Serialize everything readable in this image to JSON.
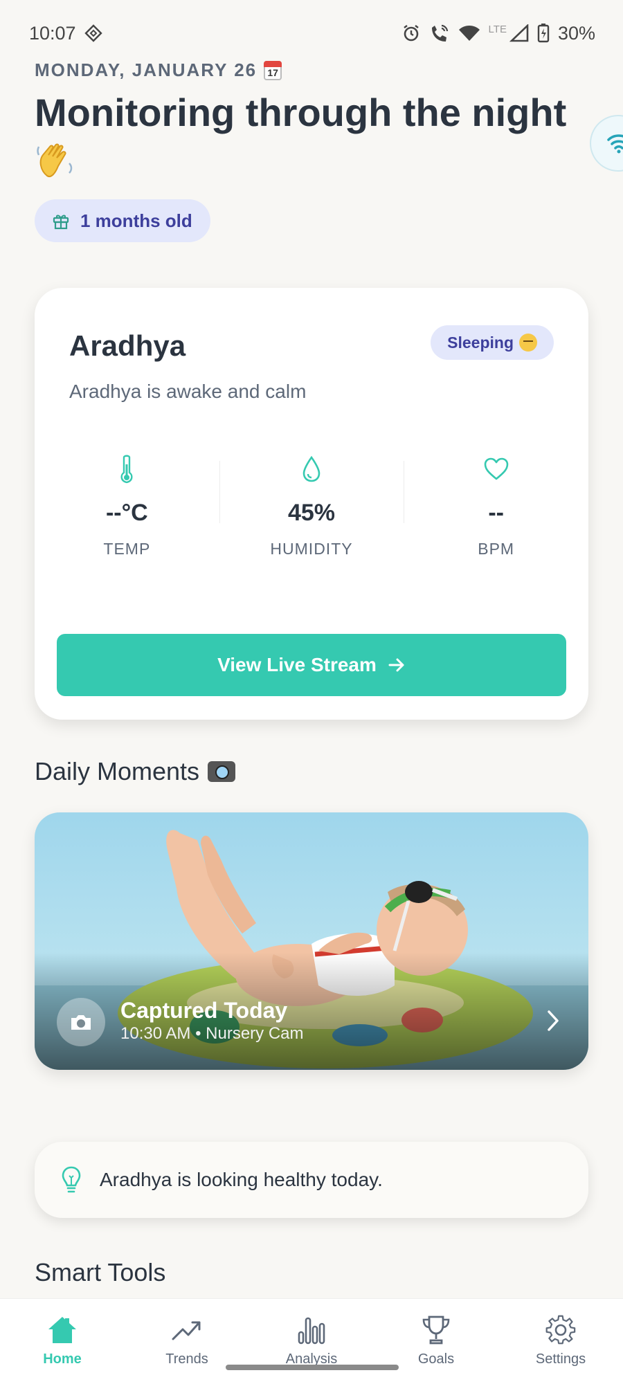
{
  "status_bar": {
    "time": "10:07",
    "network_label": "LTE",
    "battery": "30%"
  },
  "header": {
    "date": "MONDAY, JANUARY 26",
    "headline": "Monitoring through the night",
    "age_chip": "1 months old"
  },
  "monitor": {
    "baby_name": "Aradhya",
    "status_pill": "Sleeping",
    "status_description": "Aradhya is awake and calm",
    "metrics": [
      {
        "value": "--°C",
        "label": "TEMP",
        "icon": "thermometer-icon"
      },
      {
        "value": "45%",
        "label": "HUMIDITY",
        "icon": "droplet-icon"
      },
      {
        "value": "--",
        "label": "BPM",
        "icon": "heart-icon"
      }
    ],
    "live_button": "View Live Stream"
  },
  "moments": {
    "section_title": "Daily Moments",
    "card_title": "Captured Today",
    "card_meta": "10:30 AM • Nursery Cam"
  },
  "tip": {
    "text": "Aradhya is looking healthy today."
  },
  "tools": {
    "section_title": "Smart Tools"
  },
  "nav": {
    "items": [
      {
        "label": "Home",
        "icon": "home-icon",
        "active": true
      },
      {
        "label": "Trends",
        "icon": "trend-icon",
        "active": false
      },
      {
        "label": "Analysis",
        "icon": "bar-chart-icon",
        "active": false
      },
      {
        "label": "Goals",
        "icon": "trophy-icon",
        "active": false
      },
      {
        "label": "Settings",
        "icon": "gear-icon",
        "active": false
      }
    ]
  },
  "colors": {
    "accent": "#35c9b0",
    "chip_bg": "#e3e7fb",
    "chip_text": "#3d3f9c",
    "background": "#f8f7f4"
  }
}
